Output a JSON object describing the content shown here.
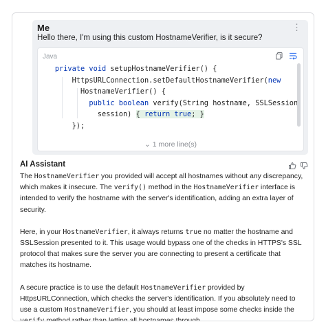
{
  "user": {
    "name": "Me",
    "message": "Hello there, I'm using this custom HostnameVerifier, is it secure?",
    "more_icon": "vertical-ellipsis"
  },
  "code": {
    "language": "Java",
    "lines": [
      [
        {
          "t": "    "
        },
        {
          "t": "private void ",
          "c": "kw"
        },
        {
          "t": "setupHostnameVerifier() {"
        }
      ],
      [
        {
          "t": "        HttpsURLConnection.setDefaultHostnameVerifier("
        },
        {
          "t": "new",
          "c": "kw"
        }
      ],
      [
        {
          "t": "          HostnameVerifier() {"
        }
      ],
      [
        {
          "t": "            "
        },
        {
          "t": "public boolean ",
          "c": "kw"
        },
        {
          "t": "verify(String hostname, SSLSession"
        }
      ],
      [
        {
          "t": "              session) "
        },
        {
          "t": "{ ",
          "c": "hl"
        },
        {
          "t": "return true",
          "c": "kw hl"
        },
        {
          "t": "; }",
          "c": "hl"
        }
      ],
      [
        {
          "t": "        });"
        }
      ]
    ],
    "more_lines": "⌄ 1 more line(s)",
    "copy_icon": "copy-icon",
    "wrap_icon": "soft-wrap-icon"
  },
  "assistant": {
    "name": "AI Assistant",
    "paragraphs": [
      [
        {
          "t": "The "
        },
        {
          "t": "HostnameVerifier",
          "code": true
        },
        {
          "t": " you provided will accept all hostnames without any discrepancy, which makes it insecure. The "
        },
        {
          "t": "verify()",
          "code": true
        },
        {
          "t": " method in the "
        },
        {
          "t": "HostnameVerifier",
          "code": true
        },
        {
          "t": " interface is intended to verify the hostname with the server's identification, adding an extra layer of security."
        }
      ],
      [
        {
          "t": "Here, in your "
        },
        {
          "t": "HostnameVerifier",
          "code": true
        },
        {
          "t": ", it always returns "
        },
        {
          "t": "true",
          "code": true
        },
        {
          "t": " no matter the hostname and SSLSession presented to it. This usage would bypass one of the checks in HTTPS's SSL protocol that makes sure the server you are connecting to present a certificate that matches its hostname."
        }
      ],
      [
        {
          "t": "A secure practice is to use the default "
        },
        {
          "t": "HostnameVerifier",
          "code": true
        },
        {
          "t": " provided by HttpsURLConnection, which checks the server's identification. If you absolutely need to use a custom "
        },
        {
          "t": "HostnameVerifier",
          "code": true
        },
        {
          "t": ", you should at least impose some checks inside the "
        },
        {
          "t": "verify",
          "code": true
        },
        {
          "t": " method rather than letting all hostnames through."
        }
      ]
    ],
    "thumbs_up_icon": "thumbs-up-icon",
    "thumbs_down_icon": "thumbs-down-icon"
  }
}
